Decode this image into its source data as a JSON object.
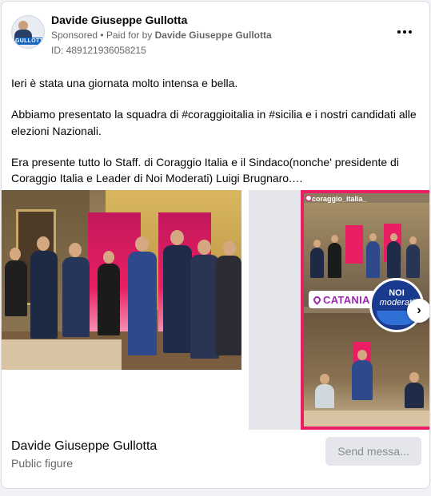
{
  "header": {
    "page_name": "Davide Giuseppe Gullotta",
    "sponsored_label": "Sponsored",
    "separator": " • ",
    "paid_for_prefix": "Paid for by ",
    "paid_for_by": "Davide Giuseppe Gullotta",
    "ad_id": "ID: 489121936058215",
    "avatar_badge": "GULLOTTA",
    "more_icon": "more-horizontal-icon"
  },
  "post": {
    "paragraphs": [
      "Ieri è stata una giornata molto intensa e bella.",
      "Abbiamo presentato la squadra di #coraggioitalia in #sicilia e i nostri candidati alle elezioni Nazionali.",
      "Era presente tutto lo Staff. di Coraggio Italia e il Sindaco(nonche' presidente di Coraggio Italia e Leader di Noi Moderati) Luigi Brugnaro.…"
    ]
  },
  "carousel": {
    "story_handle": "coraggio_italia_",
    "location_tag": "CATANIA",
    "logo_line1": "NOI",
    "logo_line2": "moderati",
    "next_icon": "chevron-right-icon",
    "next_glyph": "›"
  },
  "footer": {
    "name": "Davide Giuseppe Gullotta",
    "category": "Public figure",
    "send_button": "Send messa..."
  },
  "colors": {
    "accent_pink": "#e91e63",
    "secondary_text": "#65676b",
    "button_bg": "#e4e6eb"
  }
}
